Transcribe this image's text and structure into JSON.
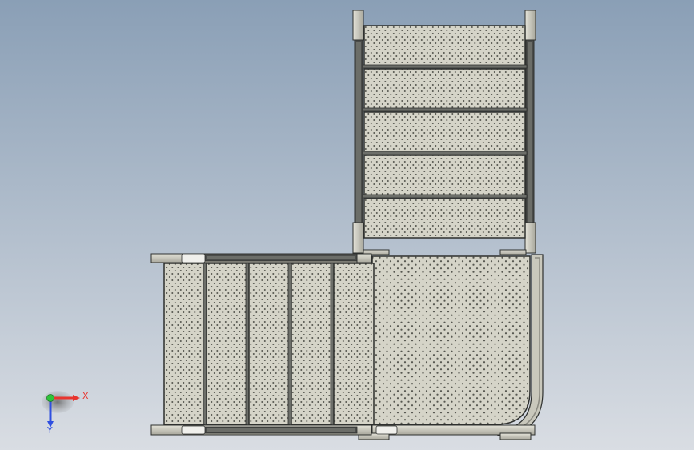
{
  "viewport": {
    "colors": {
      "background_top": "#8a9fb6",
      "background_bottom": "#d9dde3",
      "plate_fill": "#d5d4c8",
      "perforation": "#55564f",
      "frame_fill": "#c9c8bc",
      "frame_dark": "#4a4c4a",
      "outline": "#2e302e"
    }
  },
  "triad": {
    "x_label": "X",
    "y_label": "Y",
    "x_color": "#e8352f",
    "y_color": "#2ec43a",
    "z_color": "#2f4fe0"
  }
}
